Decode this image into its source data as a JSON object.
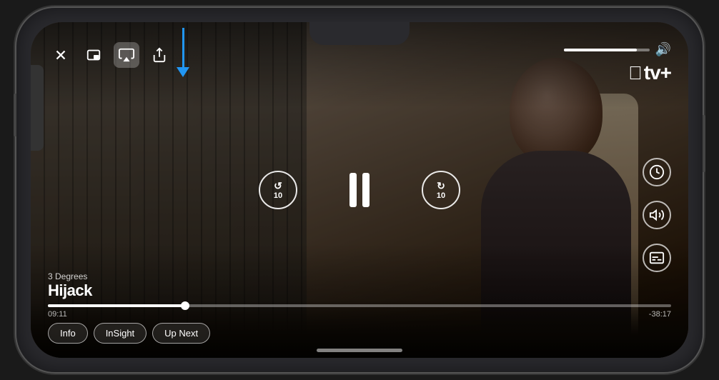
{
  "phone": {
    "title": "iPhone video player"
  },
  "video": {
    "show_subtitle": "3 Degrees",
    "show_title": "Hijack",
    "streaming_service": "tv+",
    "apple_symbol": "🍎"
  },
  "controls": {
    "close_label": "✕",
    "pip_label": "⧉",
    "airplay_label": "⬆",
    "share_label": "⬆",
    "volume_icon": "🔊",
    "volume_percent": 85,
    "skip_back_seconds": "10",
    "skip_forward_seconds": "10",
    "pause_label": "pause",
    "speed_label": "⏱",
    "audio_label": "audio",
    "subtitles_label": "subtitles"
  },
  "progress": {
    "current_time": "09:11",
    "remaining_time": "-38:17",
    "fill_percent": 22
  },
  "tabs": {
    "info_label": "Info",
    "insight_label": "InSight",
    "up_next_label": "Up Next"
  },
  "arrow": {
    "color": "#2196f3",
    "pointing_to": "airplay-button"
  }
}
